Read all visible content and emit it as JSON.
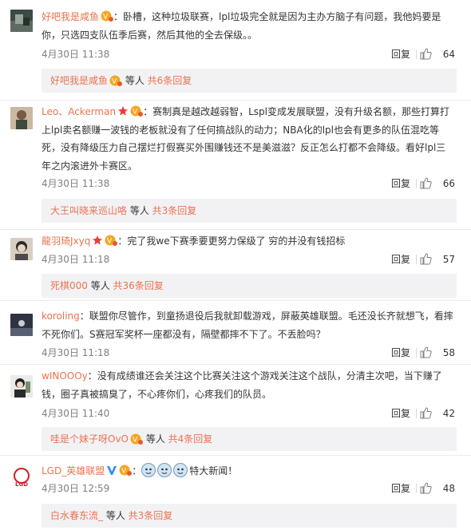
{
  "colors": {
    "username": "#eb7350",
    "text": "#333333",
    "meta": "#808080",
    "reply_bg": "#f2f2f5"
  },
  "comments": [
    {
      "username": "好吧我是咸鱼",
      "text": "卧槽，这种垃圾联赛，lpl垃圾完全就是因为主办方脑子有问题，我他妈要是你，只选四支队伍季后赛，然后其他的全去保级。。",
      "time": "4月30日 11:38",
      "reply_label": "回复",
      "likes": "64",
      "sub": {
        "username": "好吧我是咸鱼",
        "middle": " 等人 ",
        "tail": "共6条回复"
      }
    },
    {
      "username": "Leo、Ackerman",
      "text": "赛制真是越改越弱智，Lspl变成发展联盟，没有升级名额，那些打算打上lpl卖名额赚一波钱的老板就没有了任何搞战队的动力；NBA化的lpl也会有更多的队伍混吃等死，没有降级压力自己摆烂打假赛买外围赚钱还不是美滋滋？反正怎么打都不会降级。看好lpl三年之内滚进外卡赛区。",
      "time": "4月30日 11:38",
      "reply_label": "回复",
      "likes": "66",
      "sub": {
        "username": "大王叫晓来巡山咯",
        "middle": " 等人 ",
        "tail": "共3条回复"
      }
    },
    {
      "username": "龍羽琦Jxyq",
      "text": "完了我we下赛季要更努力保级了 穷的并没有钱招标",
      "time": "4月30日 11:18",
      "reply_label": "回复",
      "likes": "57",
      "sub": {
        "username": "死棋000",
        "middle": " 等人 ",
        "tail": "共36条回复"
      }
    },
    {
      "username": "koroling",
      "text": "联盟你尽管作，到童扬退役后我就卸载游戏，屏蔽英雄联盟。毛还没长齐就想飞，看摔不死你们。S赛冠军奖杯一座都没有，隔壁都摔不下了。不丢脸吗？",
      "time": "4月30日 11:18",
      "reply_label": "回复",
      "likes": "58"
    },
    {
      "username": "wINOOOy",
      "text": "没有成绩谁还会关注这个比赛关注这个游戏关注这个战队，分清主次吧，当下赚了钱，圈子真被搞臭了，不心疼你们，心疼我们的队员。",
      "time": "4月30日 11:40",
      "reply_label": "回复",
      "likes": "42",
      "sub": {
        "username": "哇是个妹子呀OvO",
        "middle": " 等人 ",
        "tail": "共4条回复"
      }
    },
    {
      "username": "LGD_英雄联盟",
      "text": "特大新闻！",
      "time": "4月30日 12:59",
      "reply_label": "回复",
      "likes": "48",
      "sub": {
        "username": "白水春东流_",
        "middle": " 等人 ",
        "tail": "共3条回复"
      }
    }
  ]
}
